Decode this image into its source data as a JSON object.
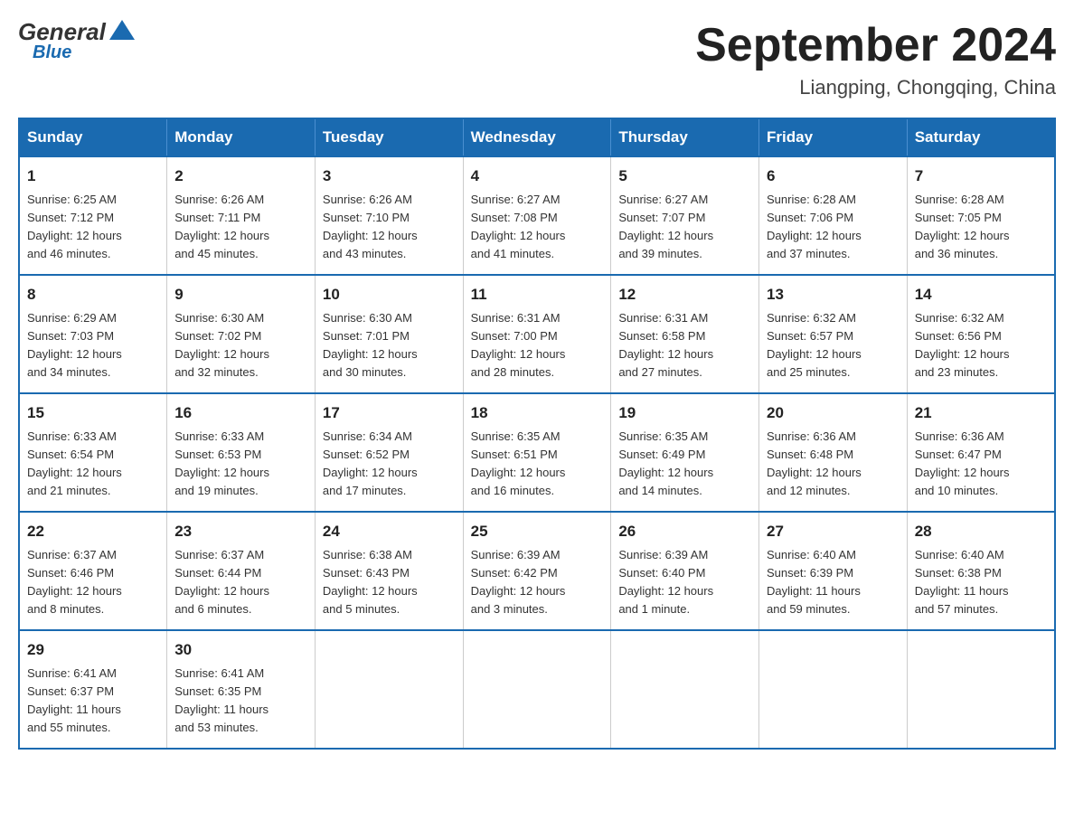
{
  "header": {
    "logo_general": "General",
    "logo_blue": "Blue",
    "month_title": "September 2024",
    "location": "Liangping, Chongqing, China"
  },
  "days_of_week": [
    "Sunday",
    "Monday",
    "Tuesday",
    "Wednesday",
    "Thursday",
    "Friday",
    "Saturday"
  ],
  "weeks": [
    [
      {
        "day": "1",
        "sunrise": "6:25 AM",
        "sunset": "7:12 PM",
        "daylight": "12 hours and 46 minutes."
      },
      {
        "day": "2",
        "sunrise": "6:26 AM",
        "sunset": "7:11 PM",
        "daylight": "12 hours and 45 minutes."
      },
      {
        "day": "3",
        "sunrise": "6:26 AM",
        "sunset": "7:10 PM",
        "daylight": "12 hours and 43 minutes."
      },
      {
        "day": "4",
        "sunrise": "6:27 AM",
        "sunset": "7:08 PM",
        "daylight": "12 hours and 41 minutes."
      },
      {
        "day": "5",
        "sunrise": "6:27 AM",
        "sunset": "7:07 PM",
        "daylight": "12 hours and 39 minutes."
      },
      {
        "day": "6",
        "sunrise": "6:28 AM",
        "sunset": "7:06 PM",
        "daylight": "12 hours and 37 minutes."
      },
      {
        "day": "7",
        "sunrise": "6:28 AM",
        "sunset": "7:05 PM",
        "daylight": "12 hours and 36 minutes."
      }
    ],
    [
      {
        "day": "8",
        "sunrise": "6:29 AM",
        "sunset": "7:03 PM",
        "daylight": "12 hours and 34 minutes."
      },
      {
        "day": "9",
        "sunrise": "6:30 AM",
        "sunset": "7:02 PM",
        "daylight": "12 hours and 32 minutes."
      },
      {
        "day": "10",
        "sunrise": "6:30 AM",
        "sunset": "7:01 PM",
        "daylight": "12 hours and 30 minutes."
      },
      {
        "day": "11",
        "sunrise": "6:31 AM",
        "sunset": "7:00 PM",
        "daylight": "12 hours and 28 minutes."
      },
      {
        "day": "12",
        "sunrise": "6:31 AM",
        "sunset": "6:58 PM",
        "daylight": "12 hours and 27 minutes."
      },
      {
        "day": "13",
        "sunrise": "6:32 AM",
        "sunset": "6:57 PM",
        "daylight": "12 hours and 25 minutes."
      },
      {
        "day": "14",
        "sunrise": "6:32 AM",
        "sunset": "6:56 PM",
        "daylight": "12 hours and 23 minutes."
      }
    ],
    [
      {
        "day": "15",
        "sunrise": "6:33 AM",
        "sunset": "6:54 PM",
        "daylight": "12 hours and 21 minutes."
      },
      {
        "day": "16",
        "sunrise": "6:33 AM",
        "sunset": "6:53 PM",
        "daylight": "12 hours and 19 minutes."
      },
      {
        "day": "17",
        "sunrise": "6:34 AM",
        "sunset": "6:52 PM",
        "daylight": "12 hours and 17 minutes."
      },
      {
        "day": "18",
        "sunrise": "6:35 AM",
        "sunset": "6:51 PM",
        "daylight": "12 hours and 16 minutes."
      },
      {
        "day": "19",
        "sunrise": "6:35 AM",
        "sunset": "6:49 PM",
        "daylight": "12 hours and 14 minutes."
      },
      {
        "day": "20",
        "sunrise": "6:36 AM",
        "sunset": "6:48 PM",
        "daylight": "12 hours and 12 minutes."
      },
      {
        "day": "21",
        "sunrise": "6:36 AM",
        "sunset": "6:47 PM",
        "daylight": "12 hours and 10 minutes."
      }
    ],
    [
      {
        "day": "22",
        "sunrise": "6:37 AM",
        "sunset": "6:46 PM",
        "daylight": "12 hours and 8 minutes."
      },
      {
        "day": "23",
        "sunrise": "6:37 AM",
        "sunset": "6:44 PM",
        "daylight": "12 hours and 6 minutes."
      },
      {
        "day": "24",
        "sunrise": "6:38 AM",
        "sunset": "6:43 PM",
        "daylight": "12 hours and 5 minutes."
      },
      {
        "day": "25",
        "sunrise": "6:39 AM",
        "sunset": "6:42 PM",
        "daylight": "12 hours and 3 minutes."
      },
      {
        "day": "26",
        "sunrise": "6:39 AM",
        "sunset": "6:40 PM",
        "daylight": "12 hours and 1 minute."
      },
      {
        "day": "27",
        "sunrise": "6:40 AM",
        "sunset": "6:39 PM",
        "daylight": "11 hours and 59 minutes."
      },
      {
        "day": "28",
        "sunrise": "6:40 AM",
        "sunset": "6:38 PM",
        "daylight": "11 hours and 57 minutes."
      }
    ],
    [
      {
        "day": "29",
        "sunrise": "6:41 AM",
        "sunset": "6:37 PM",
        "daylight": "11 hours and 55 minutes."
      },
      {
        "day": "30",
        "sunrise": "6:41 AM",
        "sunset": "6:35 PM",
        "daylight": "11 hours and 53 minutes."
      },
      null,
      null,
      null,
      null,
      null
    ]
  ],
  "labels": {
    "sunrise": "Sunrise:",
    "sunset": "Sunset:",
    "daylight": "Daylight:"
  }
}
